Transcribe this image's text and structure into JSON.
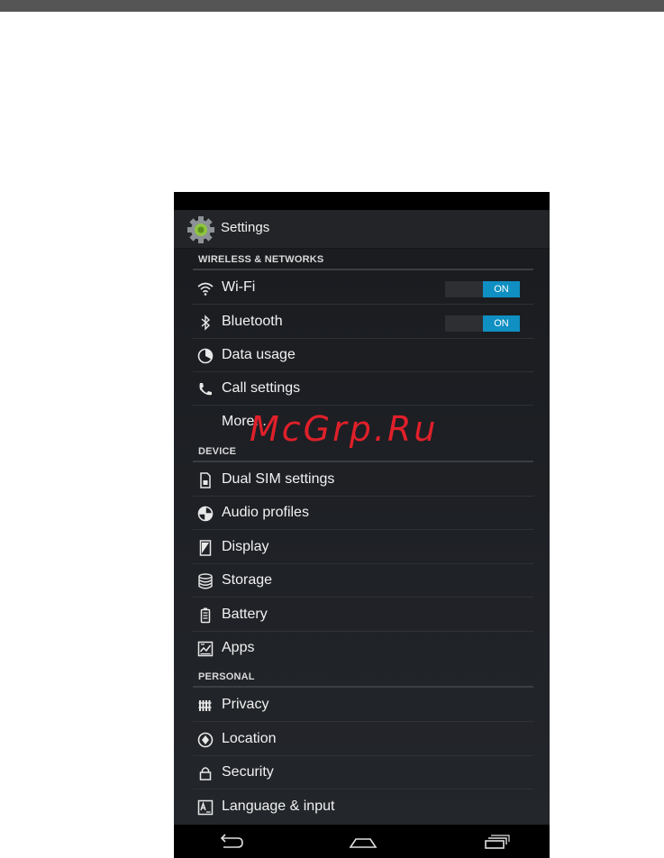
{
  "app": {
    "title": "Settings"
  },
  "sections": {
    "wireless": "WIRELESS & NETWORKS",
    "device": "DEVICE",
    "personal": "PERSONAL"
  },
  "items": {
    "wifi": {
      "label": "Wi-Fi",
      "toggle": "ON",
      "icon": "wifi-icon"
    },
    "bluetooth": {
      "label": "Bluetooth",
      "toggle": "ON",
      "icon": "bluetooth-icon"
    },
    "data_usage": {
      "label": "Data usage",
      "icon": "data-usage-icon"
    },
    "call_settings": {
      "label": "Call settings",
      "icon": "phone-icon"
    },
    "more": {
      "label": "More..."
    },
    "dual_sim": {
      "label": "Dual SIM settings",
      "icon": "sim-card-icon"
    },
    "audio_profiles": {
      "label": "Audio profiles",
      "icon": "audio-profiles-icon"
    },
    "display": {
      "label": "Display",
      "icon": "display-icon"
    },
    "storage": {
      "label": "Storage",
      "icon": "storage-icon"
    },
    "battery": {
      "label": "Battery",
      "icon": "battery-icon"
    },
    "apps": {
      "label": "Apps",
      "icon": "apps-icon"
    },
    "privacy": {
      "label": "Privacy",
      "icon": "privacy-icon"
    },
    "location": {
      "label": "Location",
      "icon": "location-icon"
    },
    "security": {
      "label": "Security",
      "icon": "lock-icon"
    },
    "language": {
      "label": "Language & input",
      "icon": "language-icon"
    }
  },
  "watermark": "McGrp.Ru",
  "colors": {
    "accent": "#0f8fc2",
    "background": "#1a1c20",
    "watermark": "#e0202a"
  }
}
